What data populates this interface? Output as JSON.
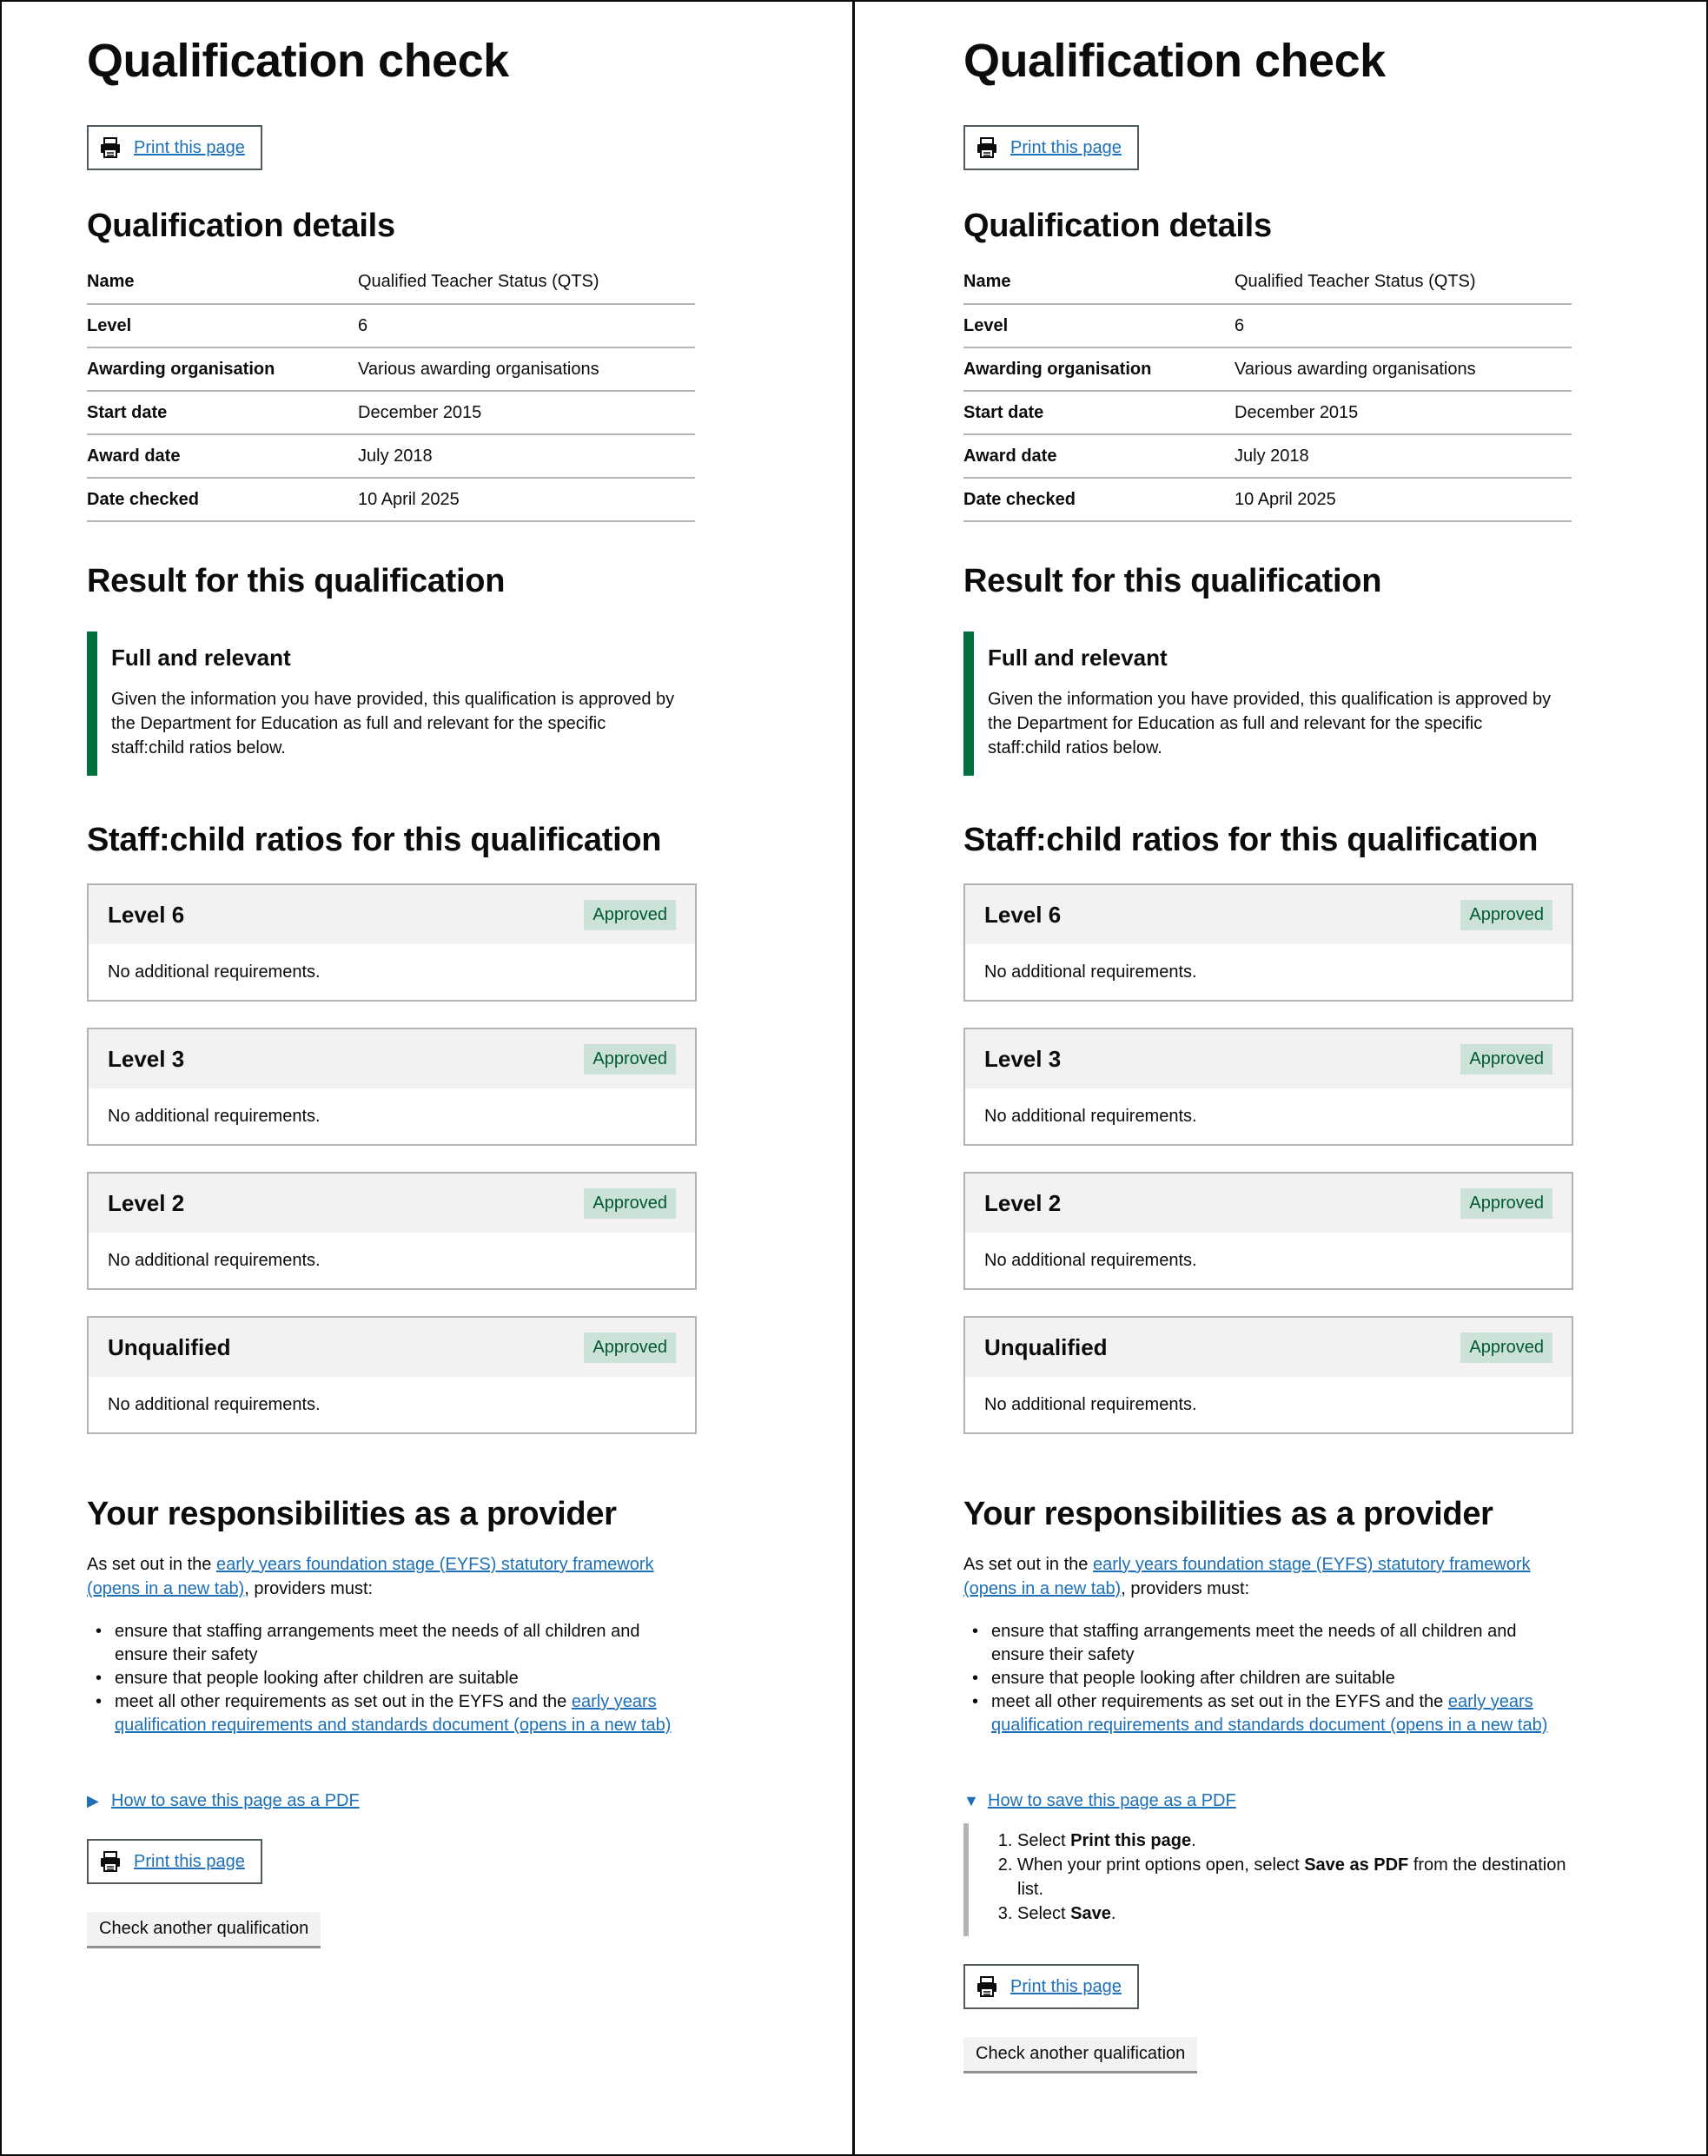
{
  "colors": {
    "link": "#1d70b8",
    "inset_border": "#00703c",
    "tag_bg": "#cce2d8",
    "tag_text": "#005a30",
    "card_header_bg": "#f3f2f1"
  },
  "page": {
    "title": "Qualification check",
    "print_label": "Print this page",
    "details_heading": "Qualification details",
    "details": [
      {
        "label": "Name",
        "value": "Qualified Teacher Status (QTS)"
      },
      {
        "label": "Level",
        "value": "6"
      },
      {
        "label": "Awarding organisation",
        "value": "Various awarding organisations"
      },
      {
        "label": "Start date",
        "value": "December 2015"
      },
      {
        "label": "Award date",
        "value": "July 2018"
      },
      {
        "label": "Date checked",
        "value": "10 April 2025"
      }
    ],
    "result_heading": "Result for this qualification",
    "result_title": "Full and relevant",
    "result_body": "Given the information you have provided, this qualification is approved by the Department for Education as full and relevant for the specific staff:child ratios below.",
    "ratios_heading": "Staff:child ratios for this qualification",
    "ratios": [
      {
        "level": "Level 6",
        "status": "Approved",
        "note": "No additional requirements."
      },
      {
        "level": "Level 3",
        "status": "Approved",
        "note": "No additional requirements."
      },
      {
        "level": "Level 2",
        "status": "Approved",
        "note": "No additional requirements."
      },
      {
        "level": "Unqualified",
        "status": "Approved",
        "note": "No additional requirements."
      }
    ],
    "resp_heading": "Your responsibilities as a provider",
    "resp_intro_pre": "As set out in the ",
    "resp_intro_link": "early years foundation stage (EYFS) statutory framework (opens in a new tab)",
    "resp_intro_post": ", providers must:",
    "resp_bullets": [
      "ensure that staffing arrangements meet the needs of all children and ensure their safety",
      "ensure that people looking after children are suitable"
    ],
    "resp_bullet3_pre": "meet all other requirements as set out in the EYFS and the ",
    "resp_bullet3_link": "early years qualification requirements and standards document (opens in a new tab)",
    "pdf_summary": "How to save this page as a PDF",
    "pdf_steps": [
      {
        "pre": "Select ",
        "bold": "Print this page",
        "post": "."
      },
      {
        "pre": "When your print options open, select ",
        "bold": "Save as PDF",
        "post": " from the destination list."
      },
      {
        "pre": "Select ",
        "bold": "Save",
        "post": "."
      }
    ],
    "check_another_label": "Check another qualification"
  }
}
